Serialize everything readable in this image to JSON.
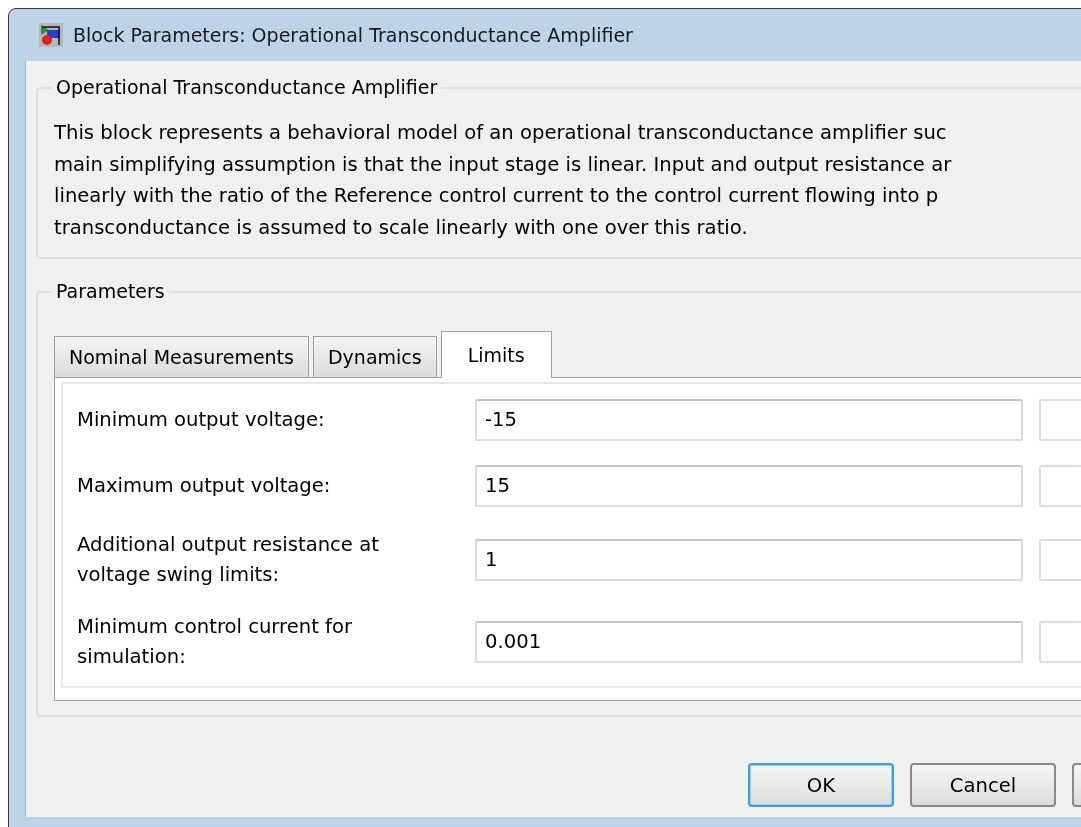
{
  "window": {
    "title": "Block Parameters: Operational Transconductance Amplifier"
  },
  "description": {
    "heading": "Operational Transconductance Amplifier",
    "lines": [
      "This block represents a behavioral model of an operational transconductance amplifier suc",
      "main simplifying assumption is that the input stage is linear. Input and output resistance ar",
      "linearly with the ratio of the Reference control current to the control current flowing into p",
      "transconductance is assumed to scale linearly with one over this ratio."
    ]
  },
  "parameters": {
    "heading": "Parameters",
    "tabs": [
      {
        "label": "Nominal Measurements",
        "selected": false
      },
      {
        "label": "Dynamics",
        "selected": false
      },
      {
        "label": "Limits",
        "selected": true
      }
    ],
    "fields": [
      {
        "label": "Minimum output voltage:",
        "value": "-15"
      },
      {
        "label": "Maximum output voltage:",
        "value": "15"
      },
      {
        "label": "Additional output resistance at voltage swing limits:",
        "value": "1"
      },
      {
        "label": "Minimum control current for simulation:",
        "value": "0.001"
      }
    ]
  },
  "buttons": [
    {
      "label": "OK",
      "default": true
    },
    {
      "label": "Cancel",
      "default": false
    }
  ]
}
